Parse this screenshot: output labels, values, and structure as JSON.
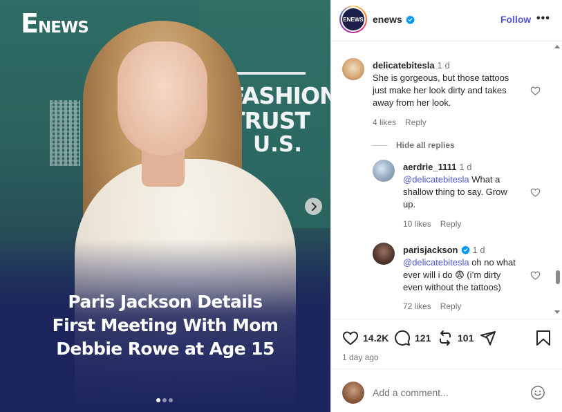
{
  "post": {
    "brand_logo": {
      "e": "E",
      "news": "NEWS"
    },
    "backdrop_sign": [
      "FASHION",
      "TRUST",
      "U.S."
    ],
    "headline_lines": [
      "Paris Jackson Details",
      "First Meeting With Mom",
      "Debbie Rowe at Age 15"
    ],
    "carousel": {
      "count": 3,
      "active": 1
    }
  },
  "header": {
    "username": "enews",
    "avatar_text": "ENEWS",
    "follow_label": "Follow",
    "more_label": "•••",
    "verified": true
  },
  "comments": [
    {
      "username": "delicatebitesla",
      "time": "1 d",
      "text": "She is gorgeous, but those tattoos just make her look dirty and takes away from her look.",
      "text_lines": [
        "She is gorgeous, but those tattoos",
        "just make her look dirty and takes",
        "away from her look."
      ],
      "likes": "4 likes",
      "reply_label": "Reply"
    }
  ],
  "hide_replies_label": "Hide all replies",
  "replies": [
    {
      "username": "aerdrie_1111",
      "time": "1 d",
      "mention": "@delicatebitesla",
      "text_lines": [
        " What a",
        "shallow thing to say. Grow",
        "up."
      ],
      "likes": "10 likes",
      "reply_label": "Reply"
    },
    {
      "username": "parisjackson",
      "verified": true,
      "time": "1 d",
      "mention": "@delicatebitesla",
      "text_lines": [
        " oh no what",
        "ever will i do 😨 (i’m dirty",
        "even without the tattoos)"
      ],
      "likes": "72 likes",
      "reply_label": "Reply"
    }
  ],
  "actions": {
    "likes": "14.2K",
    "comments": "121",
    "reposts": "101",
    "ago": "1 day ago"
  },
  "add_comment": {
    "placeholder": "Add a comment..."
  },
  "colors": {
    "accent": "#4f56d8",
    "verified": "#0095f6",
    "text": "#262626",
    "muted": "#737373"
  }
}
